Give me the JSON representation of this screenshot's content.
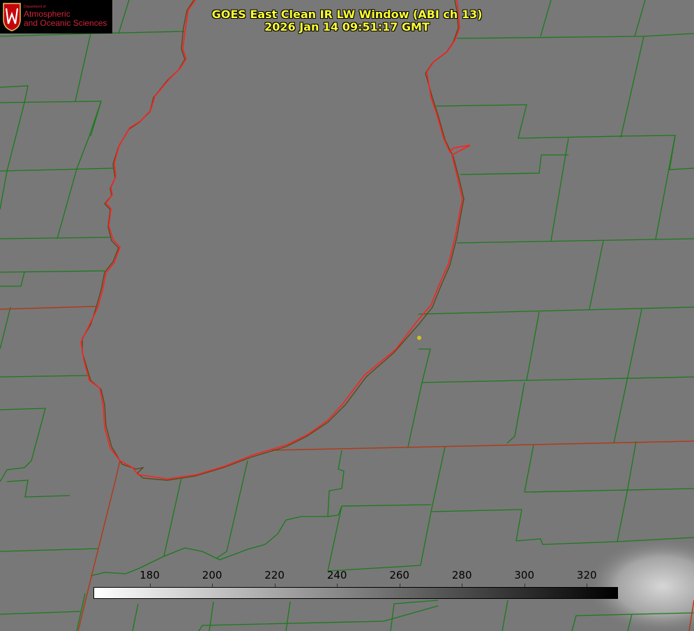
{
  "title": {
    "line1": "GOES East Clean IR LW Window (ABI ch 13)",
    "line2": "2026 Jan 14 09:51:17 GMT"
  },
  "logo": {
    "dept": "Department of",
    "line1": "Atmospheric",
    "line2": "and Oceanic Sciences"
  },
  "colorbar": {
    "ticks": [
      "180",
      "200",
      "220",
      "240",
      "260",
      "280",
      "300",
      "320"
    ],
    "tick_values": [
      180,
      200,
      220,
      240,
      260,
      280,
      300,
      320
    ],
    "range": [
      162,
      330
    ],
    "cmap_start": "#ffffff",
    "cmap_end": "#000000"
  },
  "colors": {
    "background": "#787878",
    "county_lines": "#1a7a1a",
    "state_lines": "#b03a1a",
    "coastline": "#ff2020",
    "title_text": "#ffff33",
    "marker": "#d4c020"
  }
}
